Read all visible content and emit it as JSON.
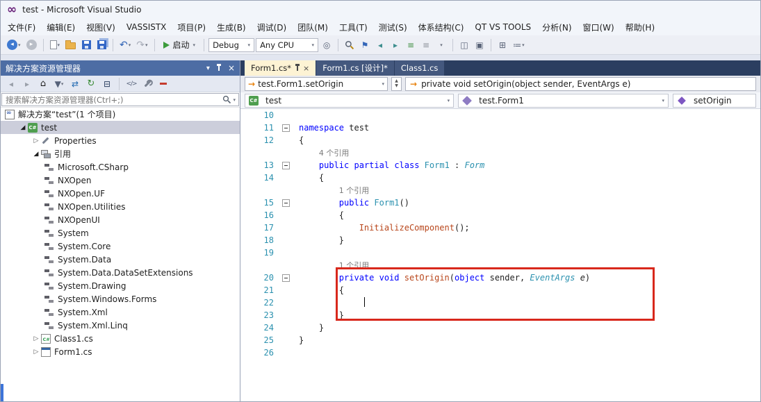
{
  "window": {
    "title": "test - Microsoft Visual Studio"
  },
  "menu": {
    "items": [
      "文件(F)",
      "编辑(E)",
      "视图(V)",
      "VASSISTX",
      "项目(P)",
      "生成(B)",
      "调试(D)",
      "团队(M)",
      "工具(T)",
      "测试(S)",
      "体系结构(C)",
      "QT VS TOOLS",
      "分析(N)",
      "窗口(W)",
      "帮助(H)"
    ]
  },
  "toolbar": {
    "start_label": "启动",
    "debug_config": "Debug",
    "platform": "Any CPU"
  },
  "solution_explorer": {
    "title": "解决方案资源管理器",
    "search_placeholder": "搜索解决方案资源管理器(Ctrl+;)",
    "tree": [
      {
        "label": "解决方案“test”(1 个项目)",
        "icon": "solution",
        "level": 0,
        "arrow": "none"
      },
      {
        "label": "test",
        "icon": "csproj",
        "level": 1,
        "arrow": "exp",
        "selected": true
      },
      {
        "label": "Properties",
        "icon": "properties",
        "level": 2,
        "arrow": "col"
      },
      {
        "label": "引用",
        "icon": "references",
        "level": 2,
        "arrow": "exp"
      },
      {
        "label": "Microsoft.CSharp",
        "icon": "assembly",
        "level": 3,
        "arrow": "none"
      },
      {
        "label": "NXOpen",
        "icon": "assembly",
        "level": 3,
        "arrow": "none"
      },
      {
        "label": "NXOpen.UF",
        "icon": "assembly",
        "level": 3,
        "arrow": "none"
      },
      {
        "label": "NXOpen.Utilities",
        "icon": "assembly",
        "level": 3,
        "arrow": "none"
      },
      {
        "label": "NXOpenUI",
        "icon": "assembly",
        "level": 3,
        "arrow": "none"
      },
      {
        "label": "System",
        "icon": "assembly",
        "level": 3,
        "arrow": "none"
      },
      {
        "label": "System.Core",
        "icon": "assembly",
        "level": 3,
        "arrow": "none"
      },
      {
        "label": "System.Data",
        "icon": "assembly",
        "level": 3,
        "arrow": "none"
      },
      {
        "label": "System.Data.DataSetExtensions",
        "icon": "assembly",
        "level": 3,
        "arrow": "none"
      },
      {
        "label": "System.Drawing",
        "icon": "assembly",
        "level": 3,
        "arrow": "none"
      },
      {
        "label": "System.Windows.Forms",
        "icon": "assembly",
        "level": 3,
        "arrow": "none"
      },
      {
        "label": "System.Xml",
        "icon": "assembly",
        "level": 3,
        "arrow": "none"
      },
      {
        "label": "System.Xml.Linq",
        "icon": "assembly",
        "level": 3,
        "arrow": "none"
      },
      {
        "label": "Class1.cs",
        "icon": "csfile",
        "level": 2,
        "arrow": "col"
      },
      {
        "label": "Form1.cs",
        "icon": "form",
        "level": 2,
        "arrow": "col"
      }
    ]
  },
  "editor": {
    "tabs": [
      {
        "label": "Form1.cs*",
        "active": true
      },
      {
        "label": "Form1.cs [设计]*",
        "active": false
      },
      {
        "label": "Class1.cs",
        "active": false
      }
    ],
    "va_bar": {
      "context": "test.Form1.setOrigin",
      "signature": "private void setOrigin(object sender, EventArgs e)"
    },
    "nav_bar": {
      "project": "test",
      "type": "test.Form1",
      "member": "setOrigin"
    },
    "code_lines": [
      {
        "n": "10",
        "tokens": []
      },
      {
        "n": "11",
        "fold": true,
        "tokens": [
          [
            "namespace",
            "kw"
          ],
          [
            " test",
            "pl"
          ]
        ]
      },
      {
        "n": "12",
        "tokens": [
          [
            "{",
            "pl"
          ]
        ]
      },
      {
        "lens": "4 个引用",
        "indent": 4
      },
      {
        "n": "13",
        "fold": true,
        "tokens": [
          [
            "    ",
            "pl"
          ],
          [
            "public",
            "kw"
          ],
          [
            " ",
            "pl"
          ],
          [
            "partial",
            "kw"
          ],
          [
            " ",
            "pl"
          ],
          [
            "class",
            "kw"
          ],
          [
            " ",
            "pl"
          ],
          [
            "Form1",
            "ty"
          ],
          [
            " : ",
            "pl"
          ],
          [
            "Form",
            "tyi"
          ]
        ]
      },
      {
        "n": "14",
        "tokens": [
          [
            "    {",
            "pl"
          ]
        ]
      },
      {
        "lens": "1 个引用",
        "indent": 8
      },
      {
        "n": "15",
        "fold": true,
        "tokens": [
          [
            "        ",
            "pl"
          ],
          [
            "public",
            "kw"
          ],
          [
            " ",
            "pl"
          ],
          [
            "Form1",
            "ty"
          ],
          [
            "()",
            "pl"
          ]
        ]
      },
      {
        "n": "16",
        "tokens": [
          [
            "        {",
            "pl"
          ]
        ]
      },
      {
        "n": "17",
        "tokens": [
          [
            "            ",
            "pl"
          ],
          [
            "InitializeComponent",
            "m"
          ],
          [
            "();",
            "pl"
          ]
        ]
      },
      {
        "n": "18",
        "tokens": [
          [
            "        }",
            "pl"
          ]
        ]
      },
      {
        "n": "19",
        "tokens": []
      },
      {
        "lens": "1 个引用",
        "indent": 8
      },
      {
        "n": "20",
        "fold": true,
        "tokens": [
          [
            "        ",
            "pl"
          ],
          [
            "private",
            "kw"
          ],
          [
            " ",
            "pl"
          ],
          [
            "void",
            "kw"
          ],
          [
            " ",
            "pl"
          ],
          [
            "setOrigin",
            "m"
          ],
          [
            "(",
            "pl"
          ],
          [
            "object",
            "kw"
          ],
          [
            " ",
            "pl"
          ],
          [
            "sender",
            "pr"
          ],
          [
            ", ",
            "pl"
          ],
          [
            "EventArgs",
            "tyi"
          ],
          [
            " ",
            "pl"
          ],
          [
            "e",
            "pli"
          ],
          [
            ")",
            "pl"
          ]
        ]
      },
      {
        "n": "21",
        "tokens": [
          [
            "        {",
            "pl"
          ]
        ]
      },
      {
        "n": "22",
        "caret": true,
        "tokens": [
          [
            "             ",
            "pl"
          ]
        ]
      },
      {
        "n": "23",
        "tokens": [
          [
            "        }",
            "pl"
          ]
        ]
      },
      {
        "n": "24",
        "tokens": [
          [
            "    }",
            "pl"
          ]
        ]
      },
      {
        "n": "25",
        "tokens": [
          [
            "}",
            "pl"
          ]
        ]
      },
      {
        "n": "26",
        "tokens": []
      }
    ]
  },
  "colors": {
    "annotation_red": "#D8281C",
    "keyword_blue": "#0000FF",
    "type_teal": "#2B91AF",
    "method_rust": "#B8461B",
    "line_number_teal": "#2B91AF",
    "codelens_gray": "#7A7A7A",
    "selection_bg": "#CCCEDB",
    "run_green": "#3C9B3C",
    "tool_header_blue": "#4D6DA4",
    "tab_well_navy": "#2B3E60",
    "active_tab_cream": "#FDF3D4"
  }
}
